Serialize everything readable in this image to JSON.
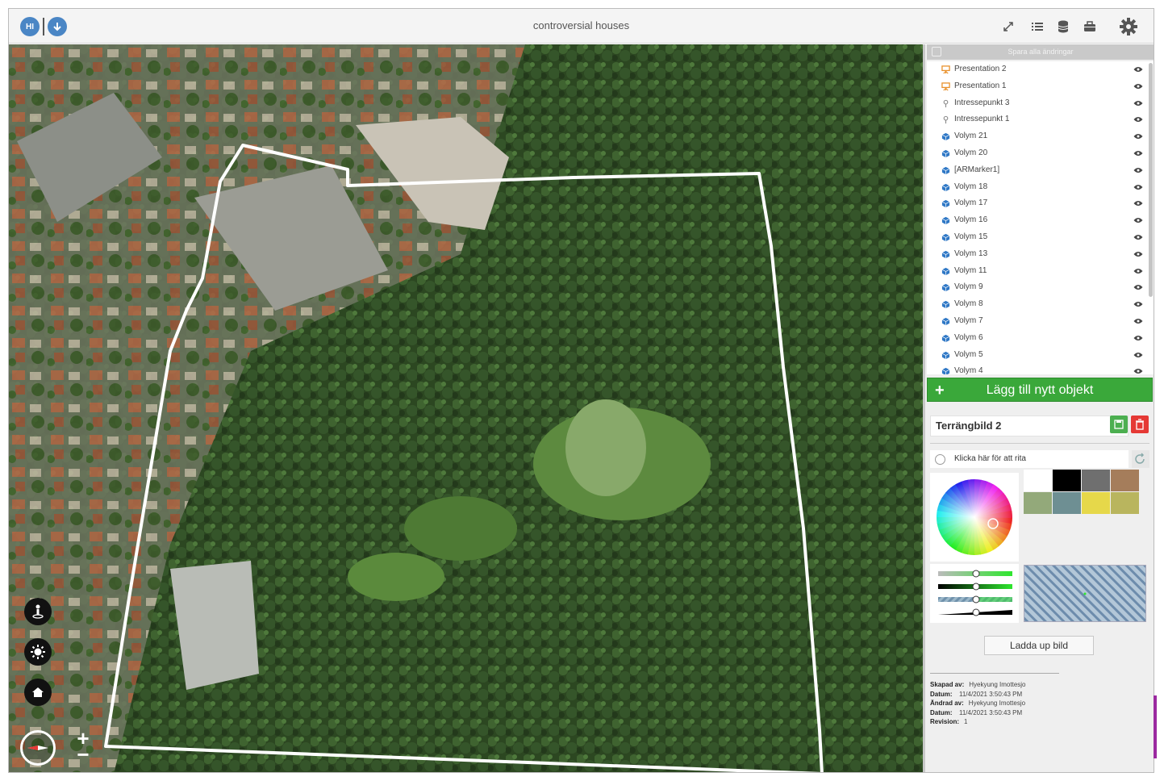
{
  "app": {
    "title": "controversial houses",
    "badge": "HI"
  },
  "toolbar": {
    "icons": [
      "expand-icon",
      "list-icon",
      "database-icon",
      "briefcase-icon",
      "gear-icon"
    ]
  },
  "sidebar": {
    "save_all_label": "Spara alla ändringar",
    "objects": [
      {
        "label": "Presentation 2",
        "icon": "presentation-icon"
      },
      {
        "label": "Presentation 1",
        "icon": "presentation-icon"
      },
      {
        "label": "Intressepunkt 3",
        "icon": "pin-icon"
      },
      {
        "label": "Intressepunkt 1",
        "icon": "pin-icon"
      },
      {
        "label": "Volym 21",
        "icon": "volume-icon"
      },
      {
        "label": "Volym 20",
        "icon": "volume-icon"
      },
      {
        "label": "[ARMarker1]",
        "icon": "volume-icon"
      },
      {
        "label": "Volym 18",
        "icon": "volume-icon"
      },
      {
        "label": "Volym 17",
        "icon": "volume-icon"
      },
      {
        "label": "Volym 16",
        "icon": "volume-icon"
      },
      {
        "label": "Volym 15",
        "icon": "volume-icon"
      },
      {
        "label": "Volym 13",
        "icon": "volume-icon"
      },
      {
        "label": "Volym 11",
        "icon": "volume-icon"
      },
      {
        "label": "Volym 9",
        "icon": "volume-icon"
      },
      {
        "label": "Volym 8",
        "icon": "volume-icon"
      },
      {
        "label": "Volym 7",
        "icon": "volume-icon"
      },
      {
        "label": "Volym 6",
        "icon": "volume-icon"
      },
      {
        "label": "Volym 5",
        "icon": "volume-icon"
      },
      {
        "label": "Volym 4",
        "icon": "volume-icon"
      }
    ],
    "add_object_label": "Lägg till nytt objekt",
    "selected_name": "Terrängbild 2",
    "draw_hint": "Klicka här för att rita",
    "upload_label": "Ladda up bild",
    "swatch_colors": [
      "#ffffff",
      "#000000",
      "#6f6f6f",
      "#a57d5b",
      "#93a97a",
      "#6e8f93",
      "#e6d84a",
      "#b9b55e"
    ],
    "meta": {
      "created_by_label": "Skapad av:",
      "created_by": "Hyekyung Imottesjo",
      "created_date_label": "Datum:",
      "created_date": "11/4/2021 3:50:43 PM",
      "changed_by_label": "Ändrad av:",
      "changed_by": "Hyekyung Imottesjo",
      "changed_date_label": "Datum:",
      "changed_date": "11/4/2021 3:50:43 PM",
      "revision_label": "Revision:",
      "revision": "1"
    }
  },
  "colors": {
    "accent_green": "#3aa83a",
    "button_blue": "#4a86c5",
    "delete_red": "#e53935"
  }
}
